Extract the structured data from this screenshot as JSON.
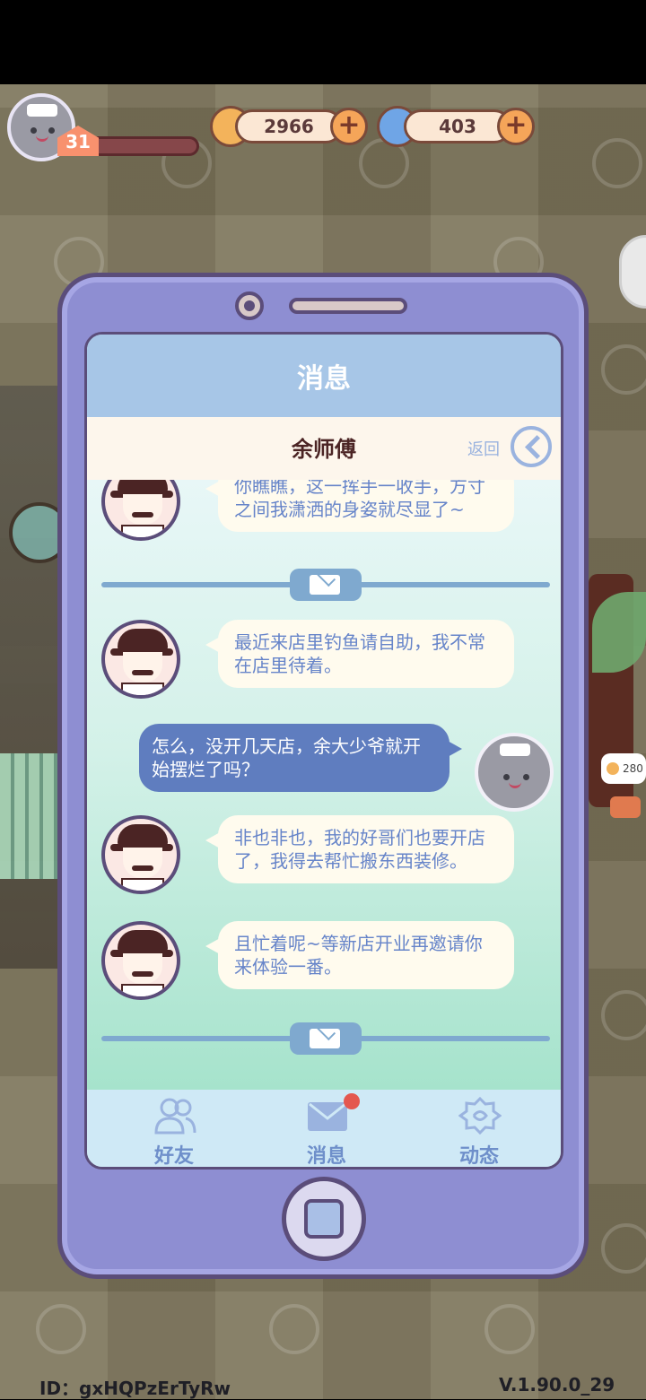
{
  "currency": {
    "coins": "2966",
    "gems": "403"
  },
  "player": {
    "level": "31",
    "level_progress": 0.08
  },
  "screen": {
    "title": "消息",
    "contact_name": "余师傅",
    "back_label": "返回"
  },
  "messages": [
    {
      "from": "npc",
      "text": "你瞧瞧，这一挥手一收手，方寸之间我潇洒的身姿就尽显了~"
    },
    {
      "from": "npc",
      "text": "最近来店里钓鱼请自助，我不常在店里待着。"
    },
    {
      "from": "me",
      "text": "怎么，没开几天店，余大少爷就开始摆烂了吗？"
    },
    {
      "from": "npc",
      "text": "非也非也，我的好哥们也要开店了，我得去帮忙搬东西装修。"
    },
    {
      "from": "npc",
      "text": "且忙着呢~等新店开业再邀请你来体验一番。"
    }
  ],
  "tabs": [
    {
      "label": "好友",
      "icon": "friends-icon"
    },
    {
      "label": "消息",
      "icon": "mail-icon",
      "has_badge": true
    },
    {
      "label": "动态",
      "icon": "activity-icon"
    }
  ],
  "scene": {
    "bubble_value": "280"
  },
  "footer": {
    "id_text": "ID：gxHQPzErTyRw",
    "version": "V.1.90.0_29"
  },
  "colors": {
    "accent_blue": "#5f7dbf",
    "phone_body": "#8e8ed2",
    "badge_red": "#e4574f"
  }
}
